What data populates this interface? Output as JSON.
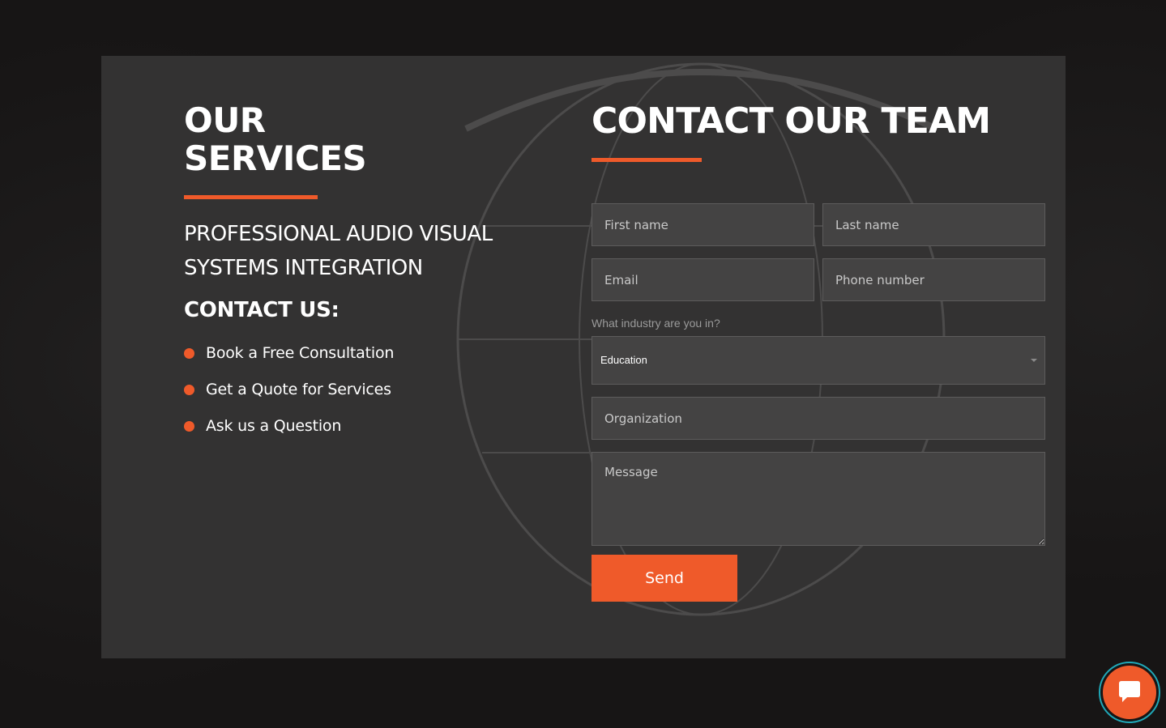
{
  "services": {
    "title_line1": "OUR",
    "title_line2": "SERVICES",
    "subtitle_line1": "PROFESSIONAL AUDIO VISUAL",
    "subtitle_line2": "SYSTEMS INTEGRATION",
    "contact_heading": "CONTACT US:",
    "links": [
      {
        "label": "Book a Free Consultation"
      },
      {
        "label": "Get a Quote for Services"
      },
      {
        "label": "Ask us a Question"
      }
    ]
  },
  "form": {
    "title": "CONTACT OUR TEAM",
    "first_name_placeholder": "First name",
    "last_name_placeholder": "Last name",
    "email_placeholder": "Email",
    "phone_placeholder": "Phone number",
    "industry_label": "What industry are you in?",
    "industry_selected": "Education",
    "organization_placeholder": "Organization",
    "message_placeholder": "Message",
    "send_label": "Send"
  },
  "chat_widget": {
    "icon": "chat-bubble-icon"
  },
  "colors": {
    "accent": "#ef5a2a",
    "panel": "#333232",
    "background": "#171515",
    "field": "#444343"
  }
}
